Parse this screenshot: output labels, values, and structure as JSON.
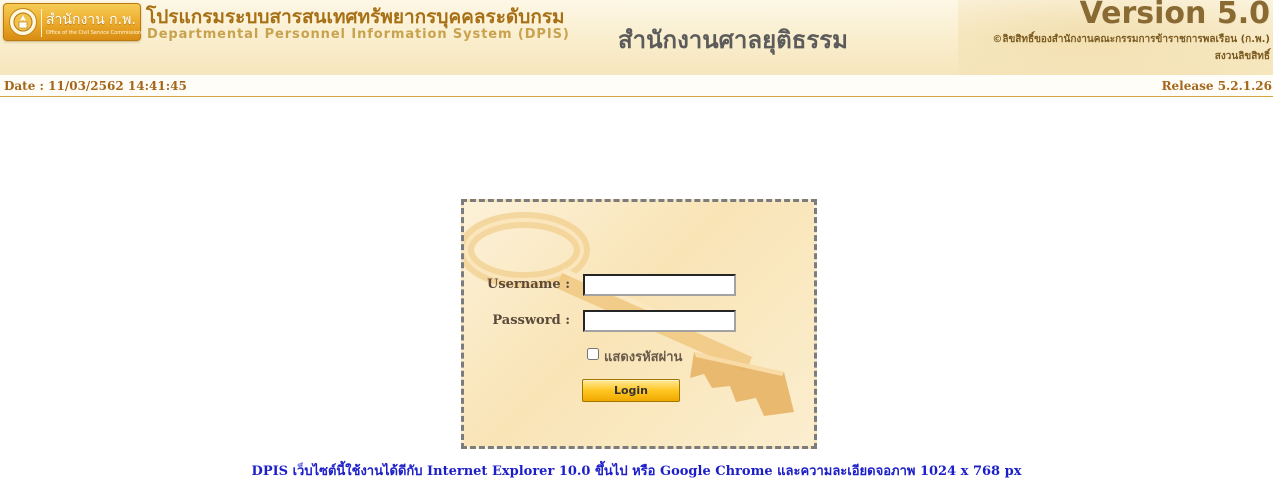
{
  "header": {
    "logo_text_th": "สำนักงาน ก.พ.",
    "logo_text_en": "Office of the Civil Service Commission",
    "program_name_th": "โปรแกรมระบบสารสนเทศทรัพยากรบุคคลระดับกรม",
    "program_name_en": "Departmental Personnel Information System (DPIS)",
    "organization": "สำนักงานศาลยุติธรรม",
    "version": "Version 5.0",
    "copyright": "©ลิขสิทธิ์ของสำนักงานคณะกรรมการข้าราชการพลเรือน (ก.พ.)",
    "rights": "สงวนลิขสิทธิ์"
  },
  "infobar": {
    "date": "Date : 11/03/2562 14:41:45",
    "release": "Release 5.2.1.26"
  },
  "login": {
    "username_label": "Username :",
    "username_value": "",
    "password_label": "Password :",
    "password_value": "",
    "show_password_label": "แสดงรหัสผ่าน",
    "show_password_checked": false,
    "login_button": "Login"
  },
  "footer": {
    "note": "DPIS เว็บไซต์นี้ใช้งานได้ดีกับ Internet Explorer 10.0 ขึ้นไป หรือ Google Chrome และความละเอียดจอภาพ 1024 x 768 px"
  },
  "icons": {
    "emblem": "ocsc-emblem-icon",
    "key": "key-illustration-icon"
  },
  "colors": {
    "banner_bg": "#f9edcc",
    "logo_gold": "#eba92a",
    "info_text": "#a5661b",
    "note_text": "#1c1ec8",
    "button_gold": "#ffc622"
  }
}
